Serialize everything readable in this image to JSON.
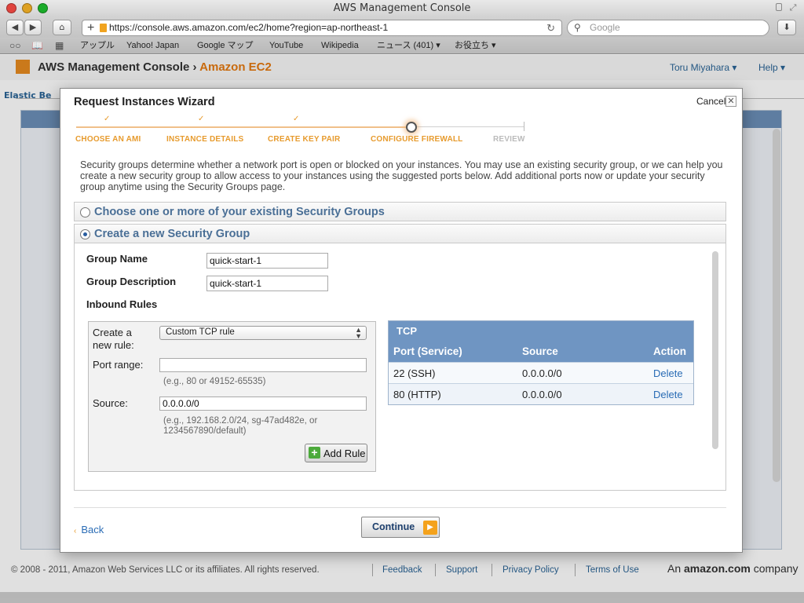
{
  "browser": {
    "window_title": "AWS Management Console",
    "url": "https://console.aws.amazon.com/ec2/home?region=ap-northeast-1",
    "search_placeholder": "Google",
    "bookmarks": [
      "アップル",
      "Yahoo! Japan",
      "Google マップ",
      "YouTube",
      "Wikipedia",
      "ニュース (401)",
      "お役立ち"
    ]
  },
  "console": {
    "title": "AWS Management Console",
    "title_sep": "›",
    "service": "Amazon EC2",
    "user": "Toru Miyahara",
    "help": "Help",
    "tab_partial": "Elastic Be"
  },
  "footer": {
    "copyright": "© 2008 - 2011, Amazon Web Services LLC or its affiliates. All rights reserved.",
    "links": [
      "Feedback",
      "Support",
      "Privacy Policy",
      "Terms of Use"
    ],
    "brand_prefix": "An",
    "brand_name": "amazon.com",
    "brand_suffix": "company"
  },
  "wizard": {
    "title": "Request Instances Wizard",
    "cancel": "Cancel",
    "close_glyph": "✕",
    "steps": [
      {
        "label": "CHOOSE AN AMI",
        "status": "done"
      },
      {
        "label": "INSTANCE DETAILS",
        "status": "done"
      },
      {
        "label": "CREATE KEY PAIR",
        "status": "done"
      },
      {
        "label": "CONFIGURE FIREWALL",
        "status": "current"
      },
      {
        "label": "REVIEW",
        "status": "pending"
      }
    ],
    "intro": "Security groups determine whether a network port is open or blocked on your instances. You may use an existing security group, or we can help you create a new security group to allow access to your instances using the suggested ports below. Add additional ports now or update your security group anytime using the Security Groups page.",
    "option_existing": "Choose one or more of your existing Security Groups",
    "option_new": "Create a new Security Group",
    "selected_option": "new",
    "group_name_label": "Group Name",
    "group_name_value": "quick-start-1",
    "group_desc_label": "Group Description",
    "group_desc_value": "quick-start-1",
    "inbound_rules_label": "Inbound Rules",
    "rule_form": {
      "create_label_1": "Create a",
      "create_label_2": "new rule:",
      "rule_type": "Custom TCP rule",
      "port_range_label": "Port range:",
      "port_range_value": "",
      "port_range_hint": "(e.g., 80 or 49152-65535)",
      "source_label": "Source:",
      "source_value": "0.0.0.0/0",
      "source_hint_1": "(e.g., 192.168.2.0/24, sg-47ad482e, or",
      "source_hint_2": "1234567890/default)",
      "add_rule": "Add Rule"
    },
    "tcp_table": {
      "caption": "TCP",
      "headers": [
        "Port (Service)",
        "Source",
        "Action"
      ],
      "rows": [
        {
          "port": "22 (SSH)",
          "source": "0.0.0.0/0",
          "action": "Delete"
        },
        {
          "port": "80 (HTTP)",
          "source": "0.0.0.0/0",
          "action": "Delete"
        }
      ]
    },
    "back": "Back",
    "continue": "Continue"
  }
}
